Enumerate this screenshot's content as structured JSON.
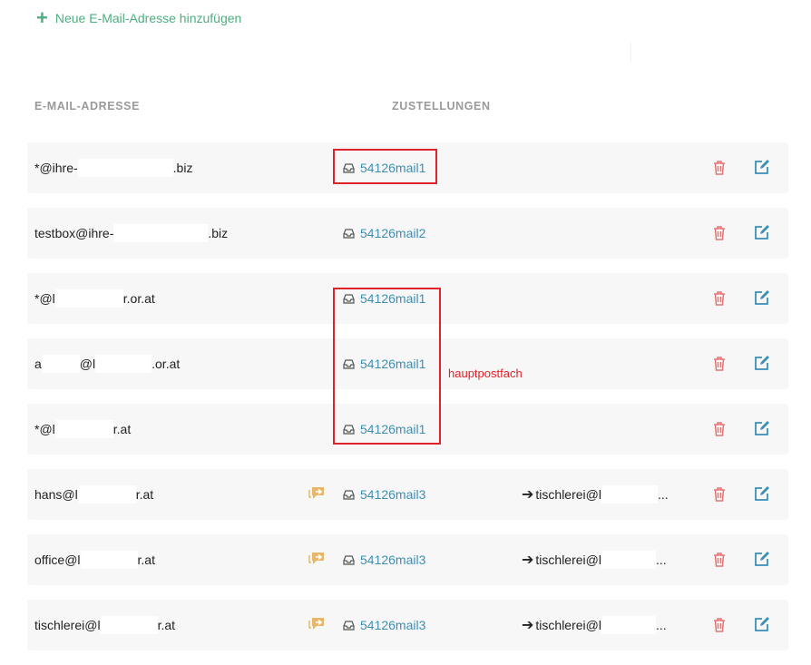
{
  "add_link": {
    "label": "Neue E-Mail-Adresse hinzufügen"
  },
  "table": {
    "headers": {
      "email": "E-MAIL-ADRESSE",
      "deliveries": "ZUSTELLUNGEN"
    },
    "rows": [
      {
        "email_prefix": "*@ihre-",
        "email_suffix": ".biz",
        "delivery": "54126mail1",
        "forward": "",
        "ellipsis": "",
        "has_forward_icon": false
      },
      {
        "email_prefix": "testbox@ihre-",
        "email_suffix": ".biz",
        "delivery": "54126mail2",
        "forward": "",
        "ellipsis": "",
        "has_forward_icon": false
      },
      {
        "email_prefix": "*@l",
        "email_suffix": "r.or.at",
        "delivery": "54126mail1",
        "forward": "",
        "ellipsis": "",
        "has_forward_icon": false
      },
      {
        "email_prefix": "a",
        "email_mid": "@l",
        "email_suffix": ".or.at",
        "delivery": "54126mail1",
        "forward": "",
        "ellipsis": "",
        "has_forward_icon": false
      },
      {
        "email_prefix": "*@l",
        "email_suffix": "r.at",
        "delivery": "54126mail1",
        "forward": "",
        "ellipsis": "",
        "has_forward_icon": false
      },
      {
        "email_prefix": "hans@l",
        "email_suffix": "r.at",
        "delivery": "54126mail3",
        "forward": "tischlerei@l",
        "ellipsis": "...",
        "has_forward_icon": true
      },
      {
        "email_prefix": "office@l",
        "email_suffix": "r.at",
        "delivery": "54126mail3",
        "forward": "tischlerei@l",
        "ellipsis": "...",
        "has_forward_icon": true
      },
      {
        "email_prefix": "tischlerei@l",
        "email_suffix": "r.at",
        "delivery": "54126mail3",
        "forward": "tischlerei@l",
        "ellipsis": "...",
        "has_forward_icon": true
      }
    ]
  },
  "annotation": {
    "note": "hauptpostfach"
  },
  "icons": {
    "add": "plus-icon",
    "inbox": "inbox-icon",
    "forward": "forward-chat-icon",
    "arrow": "arrow-right-icon",
    "delete": "trash-icon",
    "edit": "edit-icon"
  },
  "colors": {
    "accent_green": "#4caf7d",
    "link_blue": "#3a8fb7",
    "delete_red": "#e57373",
    "edit_blue": "#3a8fb7",
    "forward_orange": "#e8b86a",
    "highlight_red": "#e0222a"
  }
}
